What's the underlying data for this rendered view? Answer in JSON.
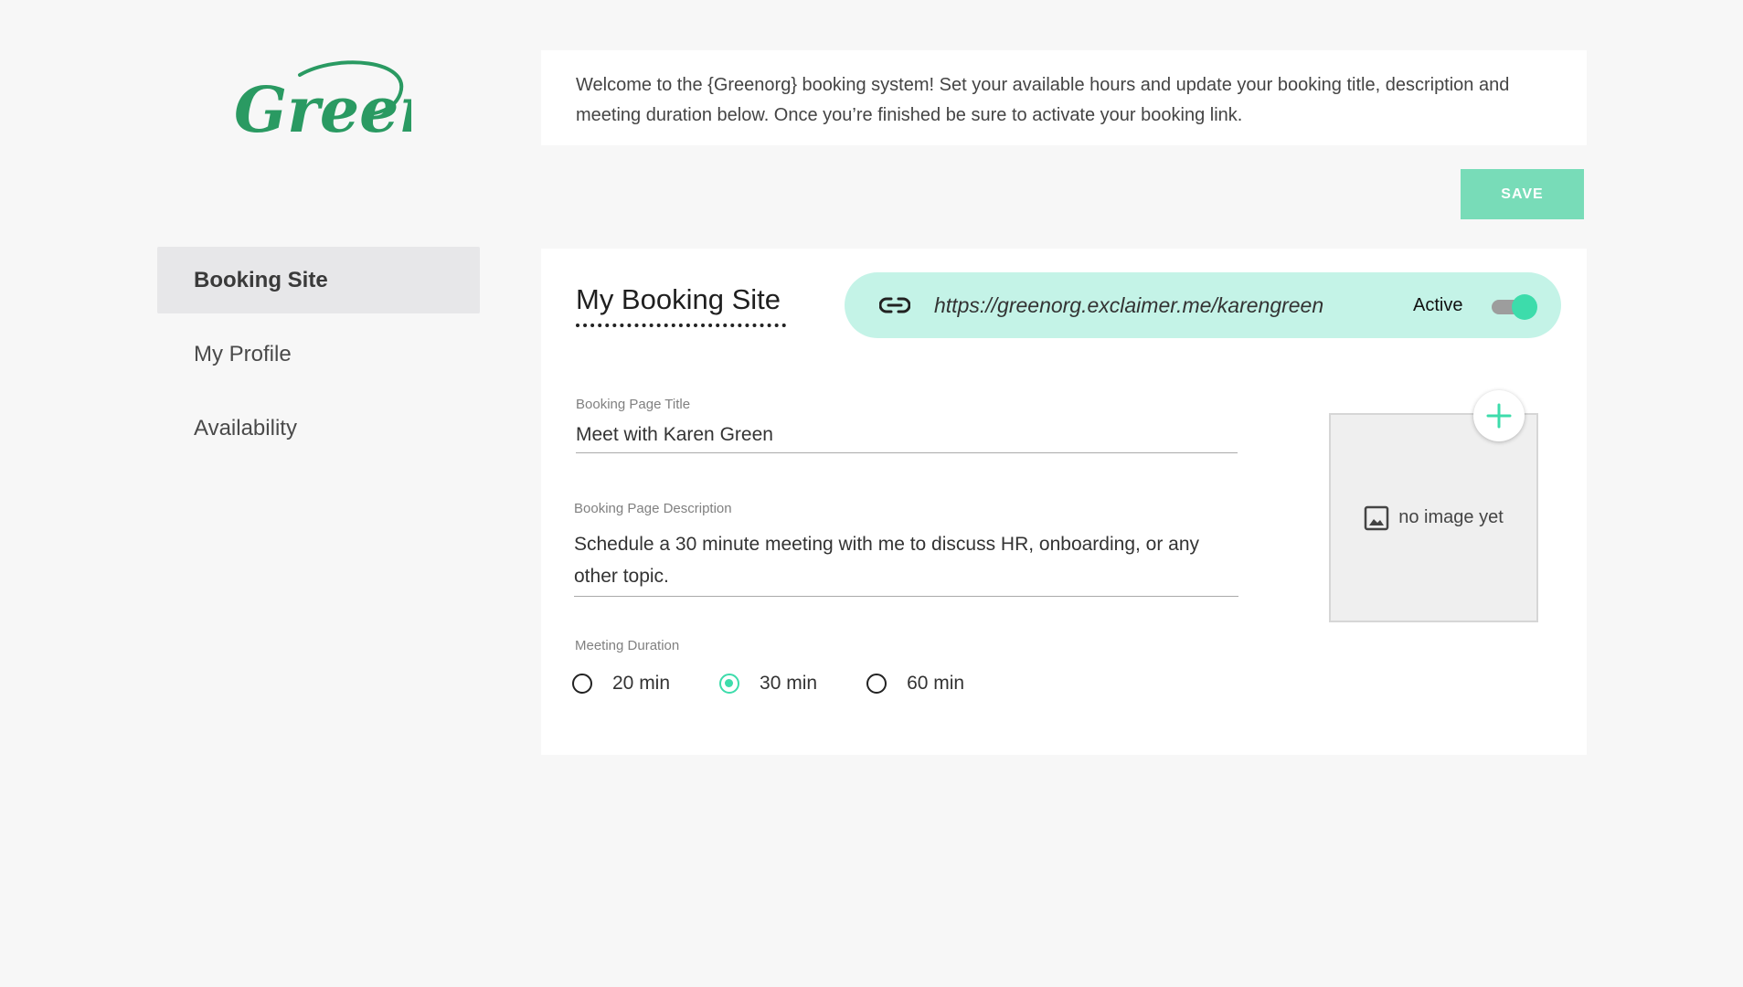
{
  "logo": {
    "text": "Green",
    "color": "#2a9a62"
  },
  "sidebar": {
    "items": [
      {
        "label": "Booking Site"
      },
      {
        "label": "My Profile"
      },
      {
        "label": "Availability"
      }
    ]
  },
  "welcome": {
    "text": "Welcome to the {Greenorg} booking system! Set your available hours and update your booking title, description and meeting duration below. Once you’re finished be sure to activate your booking link."
  },
  "toolbar": {
    "save_label": "SAVE"
  },
  "booking_site": {
    "title": "My Booking Site",
    "link_url": "https://greenorg.exclaimer.me/karengreen",
    "status_label": "Active",
    "active": true
  },
  "form": {
    "title_label": "Booking Page Title",
    "title_value": "Meet with Karen Green",
    "description_label": "Booking Page Description",
    "description_value": "Schedule a 30 minute meeting with me to discuss HR, onboarding, or any other topic.",
    "duration_label": "Meeting Duration",
    "durations": [
      {
        "label": "20 min",
        "selected": false
      },
      {
        "label": "30 min",
        "selected": true
      },
      {
        "label": "60 min",
        "selected": false
      }
    ]
  },
  "image": {
    "placeholder": "no image yet"
  },
  "colors": {
    "accent": "#3ddcab",
    "save_button": "#78dcb8",
    "link_pill": "#c4f3e7",
    "brand_green": "#2a9a62"
  }
}
